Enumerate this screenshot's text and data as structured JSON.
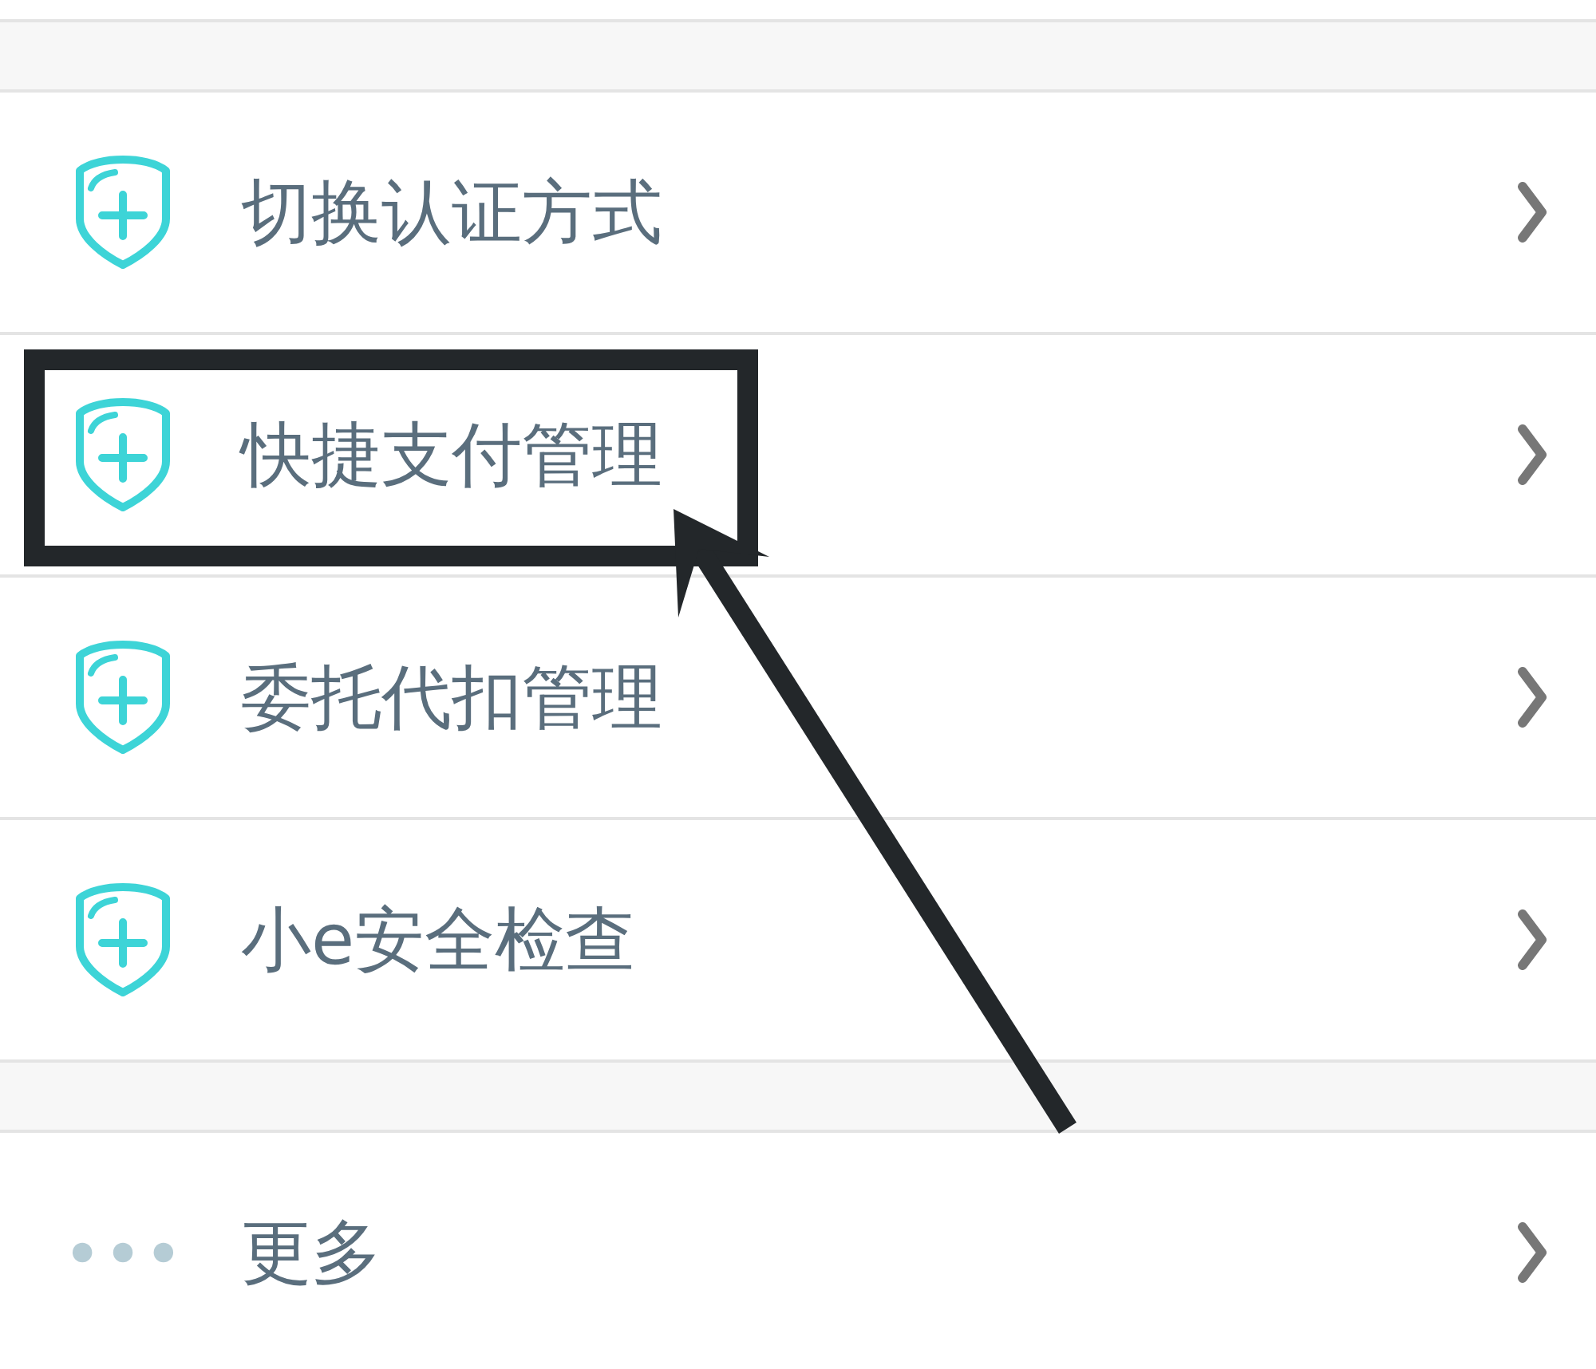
{
  "sections": [
    {
      "items": [
        {
          "kind": "shield",
          "label": "切换认证方式",
          "highlighted": false
        },
        {
          "kind": "shield",
          "label": "快捷支付管理",
          "highlighted": true
        },
        {
          "kind": "shield",
          "label": "委托代扣管理",
          "highlighted": false
        },
        {
          "kind": "shield",
          "label": "小e安全检查",
          "highlighted": false
        }
      ]
    },
    {
      "items": [
        {
          "kind": "dots",
          "label": "更多",
          "highlighted": false
        }
      ]
    }
  ]
}
